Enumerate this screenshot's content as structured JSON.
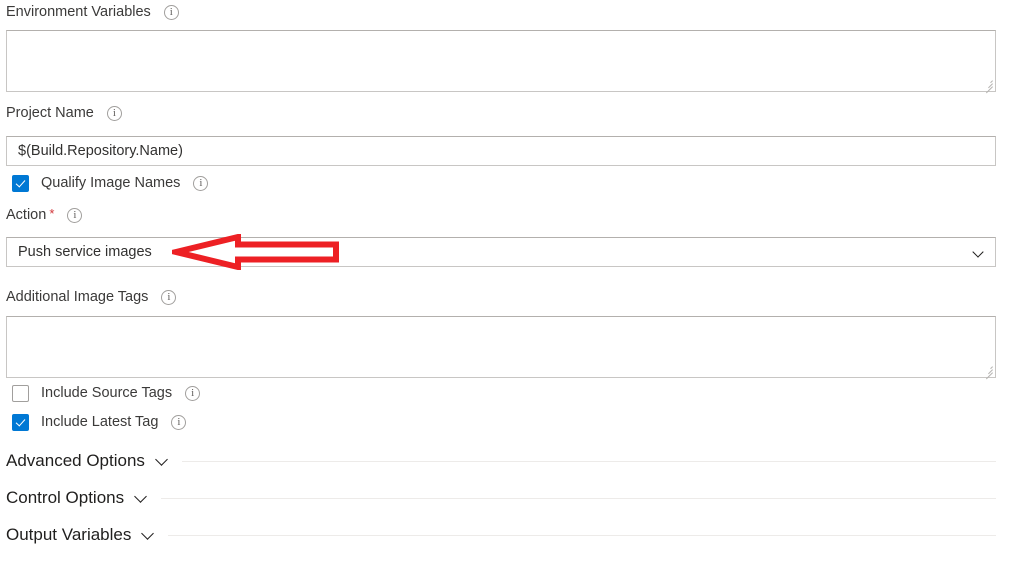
{
  "form": {
    "fields": [
      {
        "id": "environment-variables",
        "label": "Environment Variables",
        "value": "",
        "placeholder": "",
        "info_icon": "info-icon"
      },
      {
        "id": "project-name",
        "label": "Project Name",
        "value": "$(Build.Repository.Name)",
        "placeholder": "",
        "info_icon": "info-icon"
      },
      {
        "id": "action",
        "label": "Action",
        "required_marker": "*",
        "value": "Push service images",
        "info_icon": "info-icon",
        "chevron_icon": "chevron-down-icon"
      },
      {
        "id": "additional-image-tags",
        "label": "Additional Image Tags",
        "value": "",
        "placeholder": "",
        "info_icon": "info-icon"
      }
    ],
    "checkboxes": [
      {
        "id": "qualify-image-names",
        "label": "Qualify Image Names",
        "checked": true,
        "info_icon": "info-icon"
      },
      {
        "id": "include-source-tags",
        "label": "Include Source Tags",
        "checked": false,
        "info_icon": "info-icon"
      },
      {
        "id": "include-latest-tag",
        "label": "Include Latest Tag",
        "checked": true,
        "info_icon": "info-icon"
      }
    ],
    "sections": [
      {
        "id": "advanced-options",
        "label": "Advanced Options",
        "expanded": false,
        "chevron_icon": "chevron-down-icon"
      },
      {
        "id": "control-options",
        "label": "Control Options",
        "expanded": false,
        "chevron_icon": "chevron-down-icon"
      },
      {
        "id": "output-variables",
        "label": "Output Variables",
        "expanded": false,
        "chevron_icon": "chevron-down-icon"
      }
    ]
  },
  "annotation": {
    "type": "arrow",
    "name": "red-arrow-annotation",
    "direction": "left",
    "color": "#ED2024",
    "points_at": "action"
  },
  "colors": {
    "accent": "#0078d4",
    "required": "#d13438",
    "annotation": "#ED2024",
    "border": "#c8c6c4",
    "text": "#323130"
  }
}
